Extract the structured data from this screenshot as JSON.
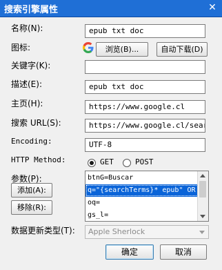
{
  "window": {
    "title": "搜索引擎属性",
    "close_glyph": "✕"
  },
  "fields": {
    "name": {
      "label": "名称(N):",
      "value": "epub txt doc"
    },
    "icon": {
      "label": "图标:",
      "browse_label": "浏览(B)...",
      "auto_download_label": "自动下载(D)"
    },
    "keyword": {
      "label": "关键字(K):",
      "value": ""
    },
    "description": {
      "label": "描述(E):",
      "value": "epub txt doc"
    },
    "homepage": {
      "label": "主页(H):",
      "value": "https://www.google.cl"
    },
    "search_url": {
      "label": "搜索 URL(S):",
      "value": "https://www.google.cl/search"
    },
    "encoding": {
      "label": "Encoding:",
      "value": "UTF-8"
    },
    "http_method": {
      "label": "HTTP Method:",
      "options": [
        "GET",
        "POST"
      ],
      "selected": "GET"
    },
    "params": {
      "label": "参数(P):",
      "add_label": "添加(A):",
      "remove_label": "移除(R):",
      "rows": [
        "btnG=Buscar",
        "q=\"{searchTerms}* epub\" OR",
        "oq=",
        "gs_l="
      ],
      "selected_index": 1
    },
    "update_type": {
      "label": "数据更新类型(T):",
      "value": "Apple Sherlock"
    }
  },
  "buttons": {
    "ok": "确定",
    "cancel": "取消"
  },
  "colors": {
    "titlebar": "#1f6fd6",
    "selection": "#0a64d8"
  }
}
